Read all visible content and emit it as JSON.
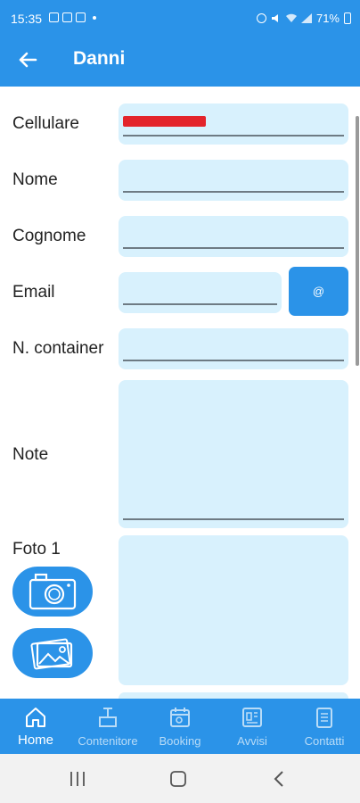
{
  "status_bar": {
    "time": "15:35",
    "battery": "71%"
  },
  "header": {
    "title": "Danni"
  },
  "form": {
    "phone_label": "Cellulare",
    "phone_value": "",
    "name_label": "Nome",
    "name_value": "",
    "surname_label": "Cognome",
    "surname_value": "",
    "email_label": "Email",
    "email_value": "",
    "email_button_label": "@",
    "container_label": "N. container",
    "container_value": "",
    "notes_label": "Note",
    "notes_value": "",
    "photo_label": "Foto 1"
  },
  "icons": {
    "back": "arrow-left-icon",
    "camera": "camera-icon",
    "gallery": "gallery-icon"
  },
  "bottom_nav": {
    "items": [
      {
        "label": "Home",
        "icon": "home-icon",
        "active": true
      },
      {
        "label": "Contenitore",
        "icon": "container-icon",
        "active": false
      },
      {
        "label": "Booking",
        "icon": "booking-icon",
        "active": false
      },
      {
        "label": "Avvisi",
        "icon": "notices-icon",
        "active": false
      },
      {
        "label": "Contatti",
        "icon": "contacts-icon",
        "active": false
      }
    ]
  },
  "colors": {
    "primary": "#2b93e8",
    "field_bg": "#d8f1fd",
    "nav_inactive": "#b9dcf7"
  }
}
